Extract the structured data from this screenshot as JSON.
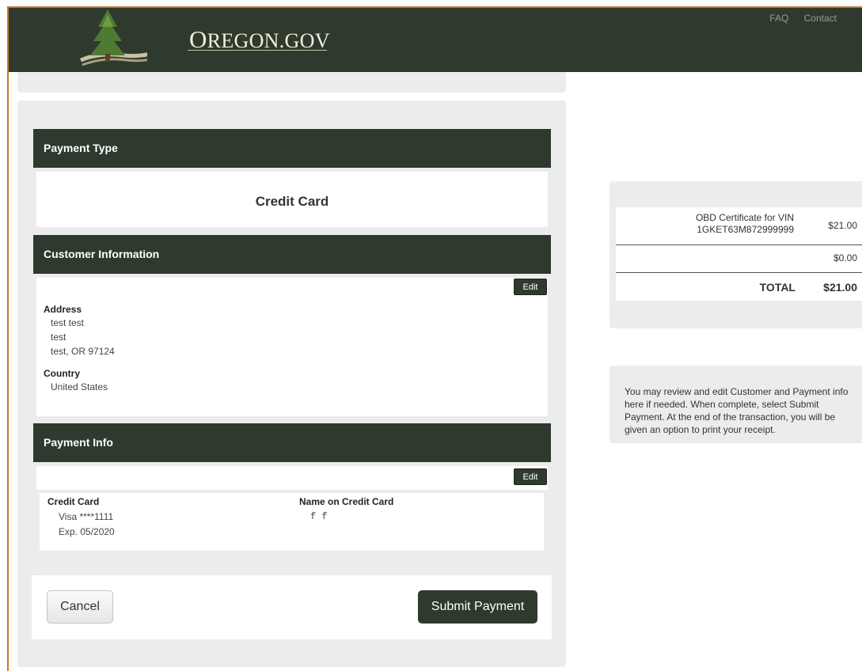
{
  "header": {
    "logo_first": "O",
    "logo_rest": "REGON.GOV",
    "nav": [
      "FAQ",
      "Contact"
    ]
  },
  "payment_type": {
    "heading": "Payment Type",
    "value": "Credit Card"
  },
  "customer_info": {
    "heading": "Customer Information",
    "edit_label": "Edit",
    "address_label": "Address",
    "address_lines": [
      "test test",
      "test",
      "test, OR 97124"
    ],
    "country_label": "Country",
    "country_value": "United States"
  },
  "payment_info": {
    "heading": "Payment Info",
    "edit_label": "Edit",
    "card_label": "Credit Card",
    "card_number": "Visa ****1111",
    "card_exp": "Exp. 05/2020",
    "name_label": "Name on Credit Card",
    "name_value": "f f"
  },
  "actions": {
    "cancel_label": "Cancel",
    "submit_label": "Submit Payment"
  },
  "summary": {
    "item_desc_line1": "OBD Certificate for VIN",
    "item_desc_line2": "1GKET63M872999999",
    "item_amount": "$21.00",
    "secondary_amount": "$0.00",
    "total_label": "TOTAL",
    "total_amount": "$21.00"
  },
  "note": {
    "text": "You may review and edit Customer and Payment info here if needed. When complete, select Submit Payment. At the end of the transaction, you will be given an option to print your receipt."
  },
  "colors": {
    "header_bg": "#2e3a2e",
    "frame_accent": "#c8772a",
    "panel_bg": "#ececec"
  }
}
